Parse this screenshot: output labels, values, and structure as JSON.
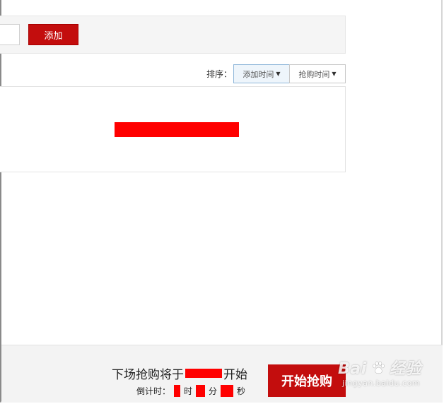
{
  "add_bar": {
    "input_value": "",
    "add_label": "添加"
  },
  "sort": {
    "label": "排序：",
    "options": [
      {
        "label": "添加时间",
        "active": true
      },
      {
        "label": "抢购时间",
        "active": false
      }
    ]
  },
  "footer": {
    "next_prefix": "下场抢购将于",
    "next_suffix": "开始",
    "countdown_label": "倒计时：",
    "unit_hour": "时",
    "unit_minute": "分",
    "unit_second": "秒",
    "start_label": "开始抢购"
  },
  "watermark": {
    "brand_left": "Bai",
    "brand_right": "经验",
    "sub": "jingyan.baidu.com"
  },
  "colors": {
    "accent_red": "#c30d0d",
    "redaction": "#ff0000",
    "active_sort_bg": "#eef5fb"
  }
}
